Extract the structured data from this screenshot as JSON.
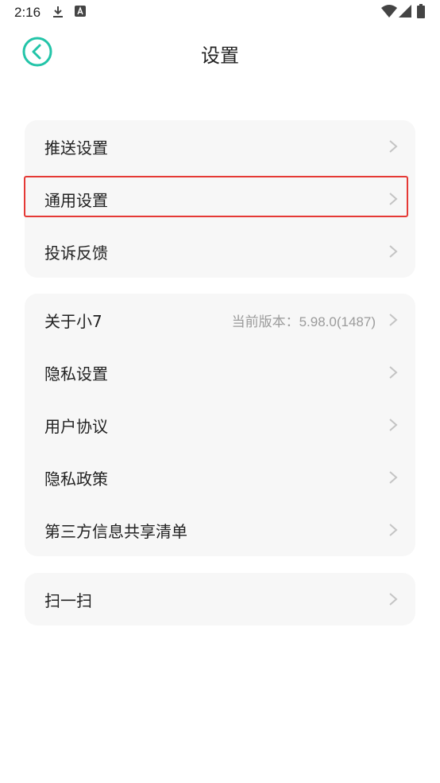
{
  "status_bar": {
    "time": "2:16",
    "icons": [
      "download-icon",
      "a-badge-icon",
      "wifi-icon",
      "signal-icon",
      "battery-icon"
    ]
  },
  "header": {
    "title": "设置",
    "back_icon": "back-arrow-icon",
    "accent_color": "#22c4a8"
  },
  "groups": [
    {
      "items": [
        {
          "label": "推送设置"
        },
        {
          "label": "通用设置",
          "highlighted": true
        },
        {
          "label": "投诉反馈"
        }
      ]
    },
    {
      "items": [
        {
          "label": "关于小7",
          "value": "当前版本：5.98.0(1487)"
        },
        {
          "label": "隐私设置"
        },
        {
          "label": "用户协议"
        },
        {
          "label": "隐私政策"
        },
        {
          "label": "第三方信息共享清单"
        }
      ]
    },
    {
      "items": [
        {
          "label": "扫一扫"
        }
      ]
    }
  ],
  "highlight_color": "#e53935"
}
